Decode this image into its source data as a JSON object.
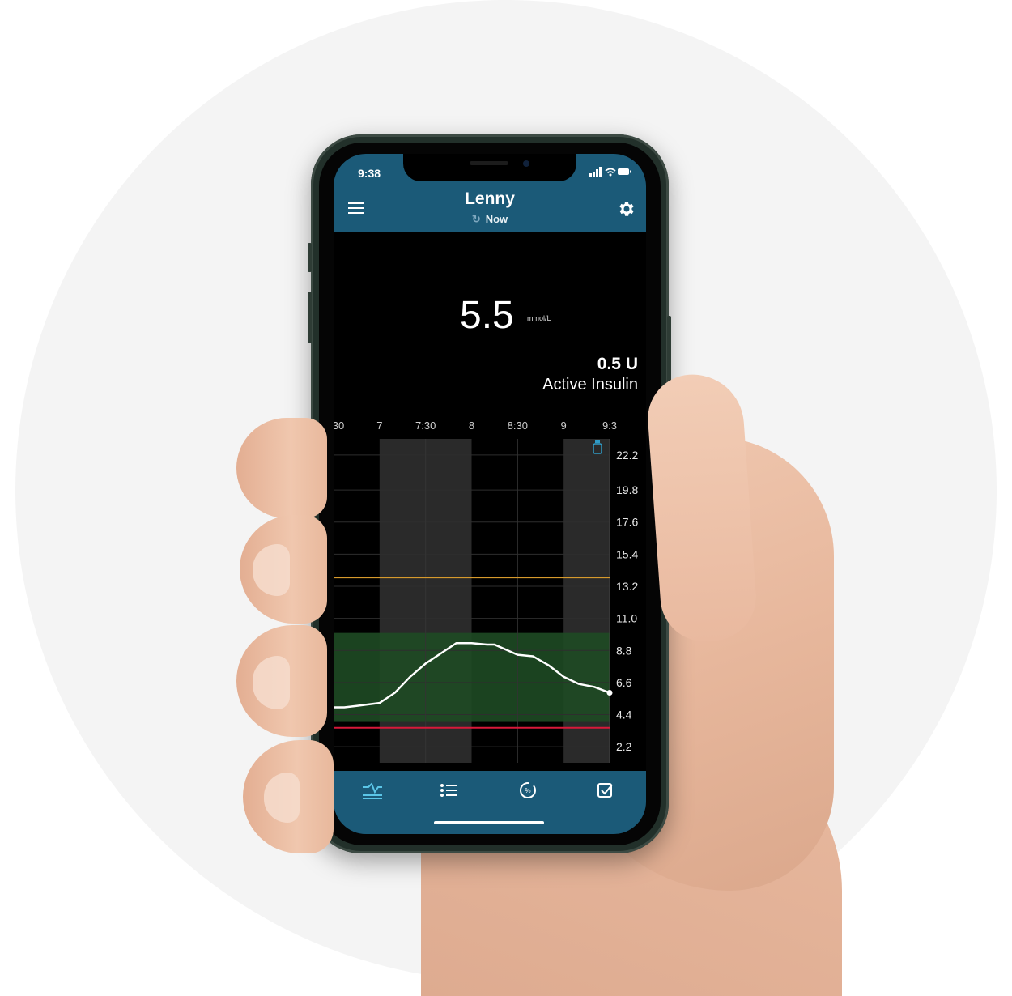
{
  "status_bar": {
    "time": "9:38",
    "icons": "signal-wifi-battery"
  },
  "header": {
    "patient_name": "Lenny",
    "sync_status": "Now",
    "menu_icon": "menu-icon",
    "settings_icon": "gear-icon"
  },
  "glucose": {
    "value": "5.5",
    "unit": "mmol/L"
  },
  "insulin": {
    "amount": "0.5 U",
    "label": "Active Insulin"
  },
  "chart_data": {
    "type": "line",
    "x_tick_labels": [
      "30",
      "7",
      "7:30",
      "8",
      "8:30",
      "9",
      "9:3"
    ],
    "y_tick_labels": [
      "22.2",
      "19.8",
      "17.6",
      "15.4",
      "13.2",
      "11.0",
      "8.8",
      "6.6",
      "4.4",
      "2.2"
    ],
    "ylim": [
      1.1,
      23.3
    ],
    "target_range": [
      3.9,
      10.0
    ],
    "high_threshold": 13.8,
    "low_threshold": 3.5,
    "series": [
      {
        "x": [
          "6:30",
          "6:37",
          "6:45",
          "7:00",
          "7:10",
          "7:20",
          "7:30",
          "7:40",
          "7:50",
          "8:00",
          "8:10",
          "8:15",
          "8:30",
          "8:40",
          "8:50",
          "9:00",
          "9:10",
          "9:20",
          "9:30"
        ],
        "values": [
          4.9,
          4.9,
          5.0,
          5.2,
          5.9,
          7.0,
          7.9,
          8.6,
          9.3,
          9.3,
          9.2,
          9.2,
          8.5,
          8.4,
          7.8,
          7.0,
          6.5,
          6.3,
          5.9
        ]
      }
    ],
    "colors": {
      "line": "#ffffff",
      "target_band": "#1e4a24",
      "high_line": "#d79a2c",
      "low_line": "#d7193a",
      "shade": "#2a2a2a",
      "insulin_marker": "#2f9bc6"
    }
  },
  "tabs": [
    {
      "name": "graph-tab",
      "icon": "graph-icon",
      "active": true
    },
    {
      "name": "list-tab",
      "icon": "list-icon",
      "active": false
    },
    {
      "name": "percent-tab",
      "icon": "percent-circle-icon",
      "active": false
    },
    {
      "name": "checklist-tab",
      "icon": "checkbox-icon",
      "active": false
    }
  ],
  "colors": {
    "app_bar": "#1b5a78",
    "background": "#000000",
    "active_tab": "#5bc6e8"
  }
}
